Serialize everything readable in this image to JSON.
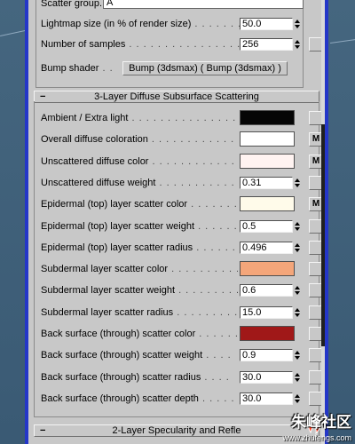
{
  "top_section": {
    "scatter_group_label": "Scatter group...",
    "scatter_group_value": "A",
    "lightmap_label": "Lightmap size (in % of render size)",
    "lightmap_value": "50.0",
    "samples_label": "Number of samples",
    "samples_value": "256",
    "bump_label": "Bump shader",
    "bump_button": "Bump (3dsmax)  ( Bump (3dsmax) )"
  },
  "rollout_3layer": {
    "toggle": "−",
    "title": "3-Layer Diffuse Subsurface Scattering",
    "rows": [
      {
        "label": "Ambient / Extra light",
        "type": "color",
        "color": "#050505",
        "map": ""
      },
      {
        "label": "Overall diffuse coloration",
        "type": "color",
        "color": "#ffffff",
        "map": "M"
      },
      {
        "label": "Unscattered diffuse color",
        "type": "color",
        "color": "#fff3f1",
        "map": "M"
      },
      {
        "label": "Unscattered diffuse weight",
        "type": "number",
        "value": "0.31",
        "map": ""
      },
      {
        "label": "Epidermal (top) layer scatter color",
        "type": "color",
        "color": "#fffbea",
        "map": "M"
      },
      {
        "label": "Epidermal (top) layer scatter weight",
        "type": "number",
        "value": "0.5",
        "map": ""
      },
      {
        "label": "Epidermal (top) layer scatter radius",
        "type": "number",
        "value": "0.496",
        "map": ""
      },
      {
        "label": "Subdermal layer scatter color",
        "type": "color",
        "color": "#f4a67a",
        "map": ""
      },
      {
        "label": "Subdermal layer scatter weight",
        "type": "number",
        "value": "0.6",
        "map": ""
      },
      {
        "label": "Subdermal layer scatter radius",
        "type": "number",
        "value": "15.0",
        "map": ""
      },
      {
        "label": "Back surface (through) scatter color",
        "type": "color",
        "color": "#a01818",
        "map": ""
      },
      {
        "label": "Back surface (through) scatter weight",
        "type": "number",
        "value": "0.9",
        "map": ""
      },
      {
        "label": "Back surface (through) scatter radius",
        "type": "number",
        "value": "30.0",
        "map": ""
      },
      {
        "label": "Back surface (through) scatter depth",
        "type": "number",
        "value": "30.0",
        "map": ""
      }
    ]
  },
  "rollout_2layer": {
    "toggle": "−",
    "title": "2-Layer Specularity and Refle"
  },
  "watermark": {
    "text": "朱峰社区",
    "sub": "www.zhufengs.com"
  }
}
